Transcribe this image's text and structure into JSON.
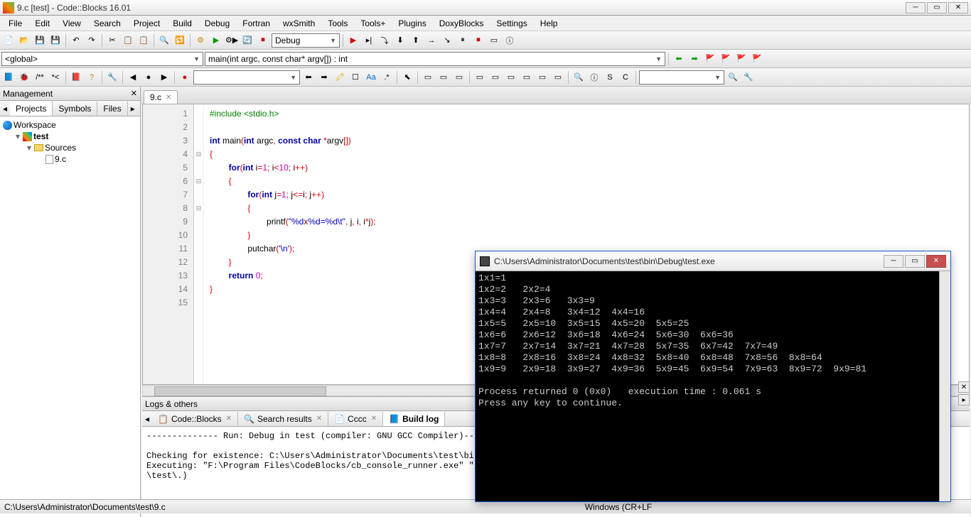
{
  "title": "9.c [test] - Code::Blocks 16.01",
  "menu": [
    "File",
    "Edit",
    "View",
    "Search",
    "Project",
    "Build",
    "Debug",
    "Fortran",
    "wxSmith",
    "Tools",
    "Tools+",
    "Plugins",
    "DoxyBlocks",
    "Settings",
    "Help"
  ],
  "buildTarget": "Debug",
  "scopeCombo": "<global>",
  "funcCombo": "main(int argc, const char* argv[]) : int",
  "mgmt": {
    "title": "Management",
    "tabs": [
      "Projects",
      "Symbols",
      "Files"
    ],
    "workspace": "Workspace",
    "project": "test",
    "folder": "Sources",
    "file": "9.c"
  },
  "editor": {
    "tab": "9.c",
    "lines": [
      {
        "n": 1,
        "h": "<span class='pp'>#include &lt;stdio.h&gt;</span>"
      },
      {
        "n": 2,
        "h": ""
      },
      {
        "n": 3,
        "h": "<span class='kw'>int</span> main<span class='op'>(</span><span class='kw'>int</span> argc<span class='op'>,</span> <span class='kw'>const</span> <span class='kw'>char</span> <span class='op'>*</span>argv<span class='op'>[])</span>"
      },
      {
        "n": 4,
        "h": "<span class='op'>{</span>"
      },
      {
        "n": 5,
        "h": "        <span class='kw'>for</span><span class='op'>(</span><span class='kw'>int</span> i<span class='op'>=</span><span class='num'>1</span><span class='op'>;</span> i<span class='op'>&lt;</span><span class='num'>10</span><span class='op'>;</span> i<span class='op'>++)</span>"
      },
      {
        "n": 6,
        "h": "        <span class='op'>{</span>"
      },
      {
        "n": 7,
        "h": "                <span class='kw'>for</span><span class='op'>(</span><span class='kw'>int</span> j<span class='op'>=</span><span class='num'>1</span><span class='op'>;</span> j<span class='op'>&lt;=</span>i<span class='op'>;</span> j<span class='op'>++)</span>"
      },
      {
        "n": 8,
        "h": "                <span class='op'>{</span>"
      },
      {
        "n": 9,
        "h": "                        printf<span class='op'>(</span><span class='str'>\"%d<span class='cm'>x</span>%d=%d\\t\"</span><span class='op'>,</span> j<span class='op'>,</span> i<span class='op'>,</span> i<span class='op'>*</span>j<span class='op'>);</span>"
      },
      {
        "n": 10,
        "h": "                <span class='op'>}</span>"
      },
      {
        "n": 11,
        "h": "                putchar<span class='op'>(</span><span class='str'>'\\n'</span><span class='op'>);</span>"
      },
      {
        "n": 12,
        "h": "        <span class='op'>}</span>"
      },
      {
        "n": 13,
        "h": "        <span class='kw'>return</span> <span class='num'>0</span><span class='op'>;</span>"
      },
      {
        "n": 14,
        "h": "<span class='op'>}</span>"
      },
      {
        "n": 15,
        "h": ""
      }
    ]
  },
  "logs": {
    "title": "Logs & others",
    "tabs": [
      "Code::Blocks",
      "Search results",
      "Cccc",
      "Build log"
    ],
    "activeTab": 3,
    "content": "-------------- Run: Debug in test (compiler: GNU GCC Compiler)--\n\nChecking for existence: C:\\Users\\Administrator\\Documents\\test\\bi\nExecuting: \"F:\\Program Files\\CodeBlocks/cb_console_runner.exe\" \"\n\\test\\.)"
  },
  "status": {
    "path": "C:\\Users\\Administrator\\Documents\\test\\9.c",
    "enc": "Windows (CR+LF"
  },
  "console": {
    "title": "C:\\Users\\Administrator\\Documents\\test\\bin\\Debug\\test.exe",
    "output": "1x1=1\n1x2=2   2x2=4\n1x3=3   2x3=6   3x3=9\n1x4=4   2x4=8   3x4=12  4x4=16\n1x5=5   2x5=10  3x5=15  4x5=20  5x5=25\n1x6=6   2x6=12  3x6=18  4x6=24  5x6=30  6x6=36\n1x7=7   2x7=14  3x7=21  4x7=28  5x7=35  6x7=42  7x7=49\n1x8=8   2x8=16  3x8=24  4x8=32  5x8=40  6x8=48  7x8=56  8x8=64\n1x9=9   2x9=18  3x9=27  4x9=36  5x9=45  6x9=54  7x9=63  8x9=72  9x9=81\n\nProcess returned 0 (0x0)   execution time : 0.061 s\nPress any key to continue."
  }
}
